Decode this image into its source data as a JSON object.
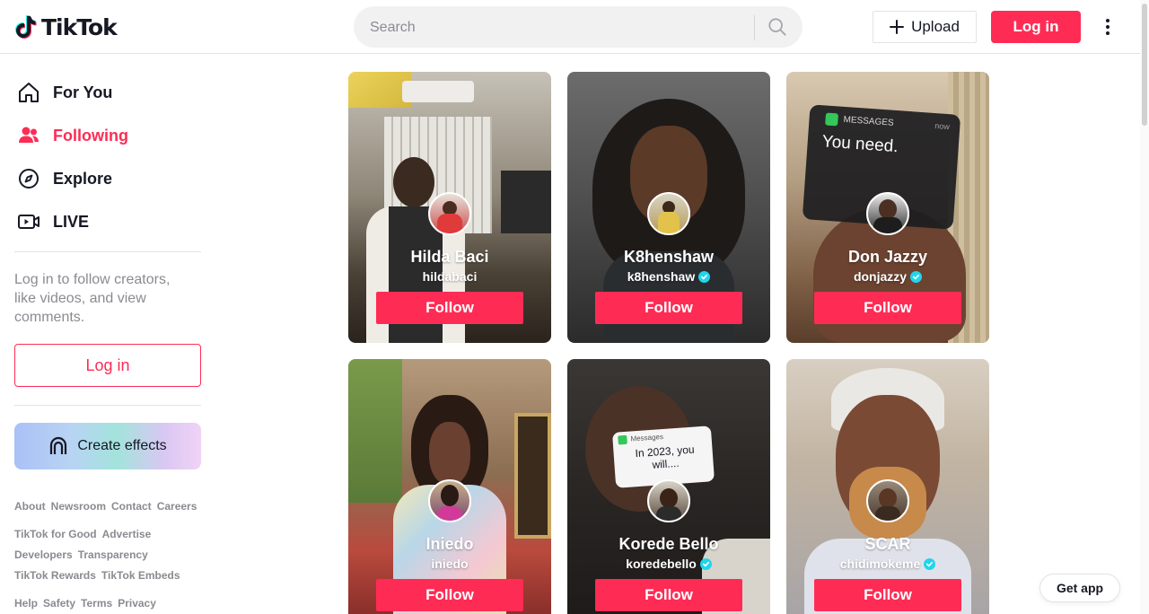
{
  "brand": {
    "name": "TikTok"
  },
  "header": {
    "search_placeholder": "Search",
    "upload_label": "Upload",
    "login_label": "Log in"
  },
  "sidebar": {
    "nav": [
      {
        "label": "For You",
        "icon": "home-icon",
        "active": false
      },
      {
        "label": "Following",
        "icon": "users-icon",
        "active": true
      },
      {
        "label": "Explore",
        "icon": "compass-icon",
        "active": false
      },
      {
        "label": "LIVE",
        "icon": "live-icon",
        "active": false
      }
    ],
    "login_hint": "Log in to follow creators, like videos, and view comments.",
    "login_label": "Log in",
    "effects_label": "Create effects",
    "footer": [
      [
        "About",
        "Newsroom",
        "Contact",
        "Careers"
      ],
      [
        "TikTok for Good",
        "Advertise"
      ],
      [
        "Developers",
        "Transparency"
      ],
      [
        "TikTok Rewards",
        "TikTok Embeds"
      ],
      [
        "Help",
        "Safety",
        "Terms",
        "Privacy"
      ]
    ]
  },
  "creators": [
    {
      "name": "Hilda Baci",
      "username": "hildabaci",
      "verified": false,
      "follow_label": "Follow"
    },
    {
      "name": "K8henshaw",
      "username": "k8henshaw",
      "verified": true,
      "follow_label": "Follow"
    },
    {
      "name": "Don Jazzy",
      "username": "donjazzy",
      "verified": true,
      "follow_label": "Follow",
      "overlay_title": "MESSAGES",
      "overlay_time": "now",
      "overlay_text": "You need."
    },
    {
      "name": "Iniedo",
      "username": "iniedo",
      "verified": false,
      "follow_label": "Follow"
    },
    {
      "name": "Korede Bello",
      "username": "koredebello",
      "verified": true,
      "follow_label": "Follow",
      "overlay_title": "Messages",
      "overlay_text": "In 2023, you will...."
    },
    {
      "name": "SCAR",
      "username": "chidimokeme",
      "verified": true,
      "follow_label": "Follow"
    }
  ],
  "get_app_label": "Get app",
  "colors": {
    "accent": "#fe2c55",
    "text": "#161823",
    "muted": "#8a8b91",
    "verified": "#20d5ec"
  }
}
